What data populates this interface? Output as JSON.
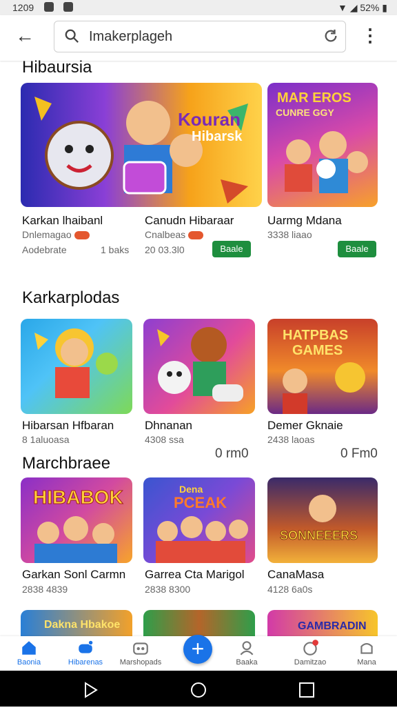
{
  "status": {
    "time": "1209",
    "battery": "52%"
  },
  "search": {
    "value": "Imakerplageh"
  },
  "sections": [
    {
      "title": "Hibaursia",
      "cards": [
        {
          "title": "Karkan lhaibanl",
          "line1": "Dnlemagao",
          "line2": "Aodebrate",
          "extra": "1 baks"
        },
        {
          "title": "Canudn Hibaraar",
          "line1": "Cnalbeas",
          "line2": "20 03.3l0",
          "button": "Baale"
        },
        {
          "title": "Uarmg Mdana",
          "line1": "3338 liaao",
          "button": "Baale"
        }
      ]
    },
    {
      "title": "Karkarplodas",
      "cards": [
        {
          "title": "Hibarsan Hfbaran",
          "line1": "8 1aluoasa"
        },
        {
          "title": "Dhnanan",
          "line1": "4308 ssa",
          "price": "0 rm0"
        },
        {
          "title": "Demer Gknaie",
          "line1": "2438 laoas",
          "price": "0 Fm0"
        }
      ]
    },
    {
      "title": "Marchbraee",
      "cards": [
        {
          "title": "Garkan Sonl Carmn",
          "line1": "2838 4839"
        },
        {
          "title": "Garrea Cta Marigol",
          "line1": "2838 8300"
        },
        {
          "title": "CanaMasa",
          "line1": "4128 6a0s"
        }
      ]
    }
  ],
  "art": [
    {
      "text1": "Kouran",
      "text2": "Hibarsk"
    },
    {
      "text1": "MAR EROS",
      "text2": "CUNRE GGY"
    },
    {
      "text1": ""
    },
    {
      "text1": ""
    },
    {
      "text1": "HATPBAS",
      "text2": "GAMES"
    },
    {
      "text1": "HIBABOK"
    },
    {
      "text1": "Dena",
      "text2": "PCEAK"
    },
    {
      "text1": "SONNEEERS"
    },
    {
      "text1": "Dakna Hbakoe"
    },
    {
      "text1": ""
    },
    {
      "text1": "GAMBRADIN"
    }
  ],
  "nav": [
    {
      "label": "Baonia"
    },
    {
      "label": "Hibarenas"
    },
    {
      "label": "Marshopads"
    },
    {
      "label": "Baaka"
    },
    {
      "label": "Damitzao"
    },
    {
      "label": "Mana"
    }
  ],
  "colors": {
    "accent": "#1a73e8",
    "install_green": "#1e8e3e",
    "badge_red": "#e4572e"
  }
}
